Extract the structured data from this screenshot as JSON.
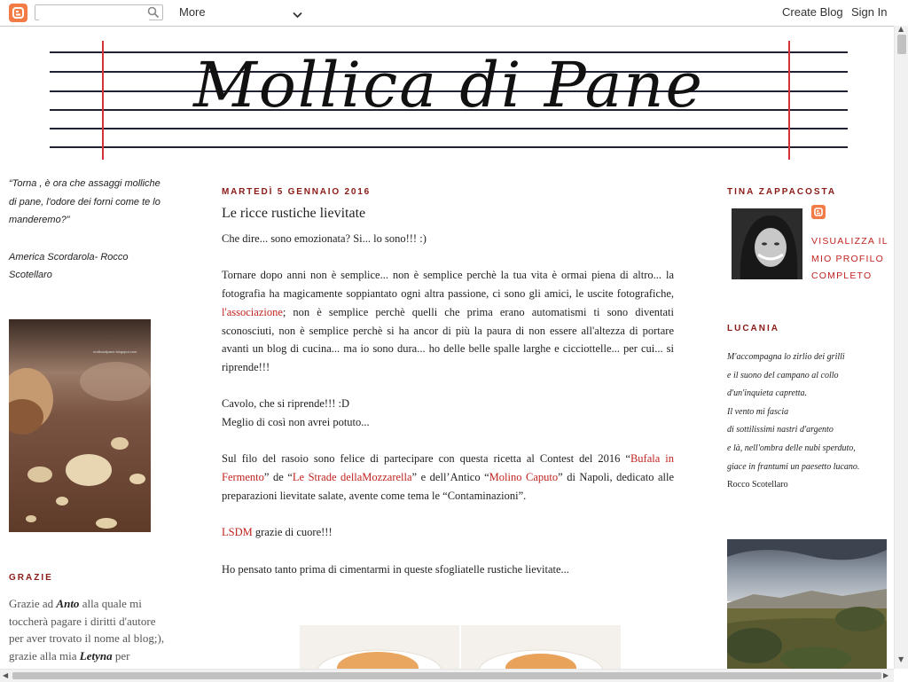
{
  "navbar": {
    "search_placeholder": "",
    "more_label": "More",
    "create_blog": "Create Blog",
    "sign_in": "Sign In"
  },
  "header": {
    "blog_title": "Mollica di Pane"
  },
  "left_sidebar": {
    "quote_text": "“Torna , è ora che assaggi molliche di pane, l'odore dei forni come te lo manderemo?”",
    "quote_author": "America Scordarola- Rocco Scotellaro",
    "photo_watermark": "mollicadipane.blogspot.com",
    "grazie_heading": "GRAZIE",
    "grazie_t1": "Grazie ad ",
    "grazie_b1": "Anto",
    "grazie_l1": " alla quale mi",
    "grazie_t2": "toccherà pagare i diritti d'autore per aver trovato il nome al blog;), grazie alla mia ",
    "grazie_b2": "Letyna",
    "grazie_t3": " per"
  },
  "post": {
    "date": "MARTEDÌ 5 GENNAIO 2016",
    "title": "Le ricce rustiche lievitate",
    "p1": "Che dire... sono emozionata? Si... lo sono!!! :)",
    "p2a": "Tornare dopo anni non è semplice... non è semplice perchè la tua vita è ormai piena di altro... la fotografia ha magicamente soppiantato ogni altra passione, ci sono gli amici, le uscite fotografiche, ",
    "p2_link": "l'associazione",
    "p2b": "; non è semplice perchè quelli che prima erano automatismi ti sono diventati sconosciuti, non è semplice perchè si ha ancor di più la paura di non essere all'altezza di portare avanti un blog di cucina... ma io sono dura... ho delle belle spalle larghe e cicciottelle... per cui... si riprende!!!",
    "p3a": "Cavolo, che si riprende!!! :D",
    "p3b": "Meglio di così non avrei potuto...",
    "p4a": "Sul filo del rasoio sono felice di partecipare con questa ricetta al Contest del 2016 “",
    "p4_link1": "Bufala in Fermento",
    "p4b": "” de “",
    "p4_link2": "Le Strade dellaMozzarella",
    "p4c": "” e dell’Antico “",
    "p4_link3": "Molino Caputo",
    "p4d": "” di Napoli, dedicato alle preparazioni lievitate salate, avente come tema le “Contaminazioni”.",
    "p5_link": "LSDM",
    "p5": " grazie di cuore!!!",
    "p6": "Ho pensato tanto prima di cimentarmi in queste sfogliatelle rustiche lievitate..."
  },
  "right_sidebar": {
    "profile_heading": "TINA ZAPPACOSTA",
    "profile_link": "VISUALIZZA IL MIO PROFILO COMPLETO",
    "lucania_heading": "LUCANIA",
    "poem_lines": [
      "M'accompagna lo zirlio dei grilli",
      "e il suono del campano al collo",
      "d'un'inquieta capretta.",
      "Il vento mi fascia",
      "di sottilissimi nastri d'argento",
      "e là, nell'ombra delle nubi sperduto,",
      "giace in frantumi un paesetto lucano."
    ],
    "poem_author": "Rocco Scotellaro"
  },
  "colors": {
    "accent_red": "#c0231f",
    "heading_red": "#8a1b17",
    "blogger_orange": "#f37b45"
  }
}
